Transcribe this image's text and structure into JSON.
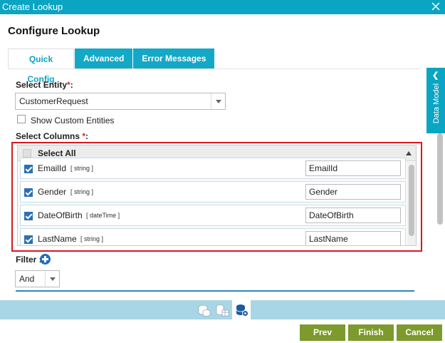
{
  "window": {
    "title": "Create Lookup"
  },
  "heading": "Configure Lookup",
  "tabs": [
    {
      "label": "Quick Config",
      "active": true
    },
    {
      "label": "Advanced",
      "active": false
    },
    {
      "label": "Error Messages",
      "active": false
    }
  ],
  "entity": {
    "label": "Select Entity",
    "required_mark": "*",
    "colon": ":",
    "value": "CustomerRequest"
  },
  "show_custom": {
    "label": "Show Custom Entities",
    "checked": false
  },
  "columns": {
    "label": "Select Columns",
    "required_mark": "*",
    "colon": ":",
    "select_all_label": "Select All",
    "rows": [
      {
        "name": "EmailId",
        "type": "[ string ]",
        "value": "EmailId",
        "checked": true
      },
      {
        "name": "Gender",
        "type": "[ string ]",
        "value": "Gender",
        "checked": true
      },
      {
        "name": "DateOfBirth",
        "type": "[ dateTime ]",
        "value": "DateOfBirth",
        "checked": true
      },
      {
        "name": "LastName",
        "type": "[ string ]",
        "value": "LastName",
        "checked": true
      }
    ]
  },
  "filter": {
    "label": "Filter :",
    "operator": "And"
  },
  "side_panel": {
    "label": "Data Model"
  },
  "buttons": {
    "prev": "Prev",
    "finish": "Finish",
    "cancel": "Cancel"
  },
  "colors": {
    "header": "#0aa5c3",
    "button": "#7d9a2c",
    "highlight": "#d8171f"
  }
}
